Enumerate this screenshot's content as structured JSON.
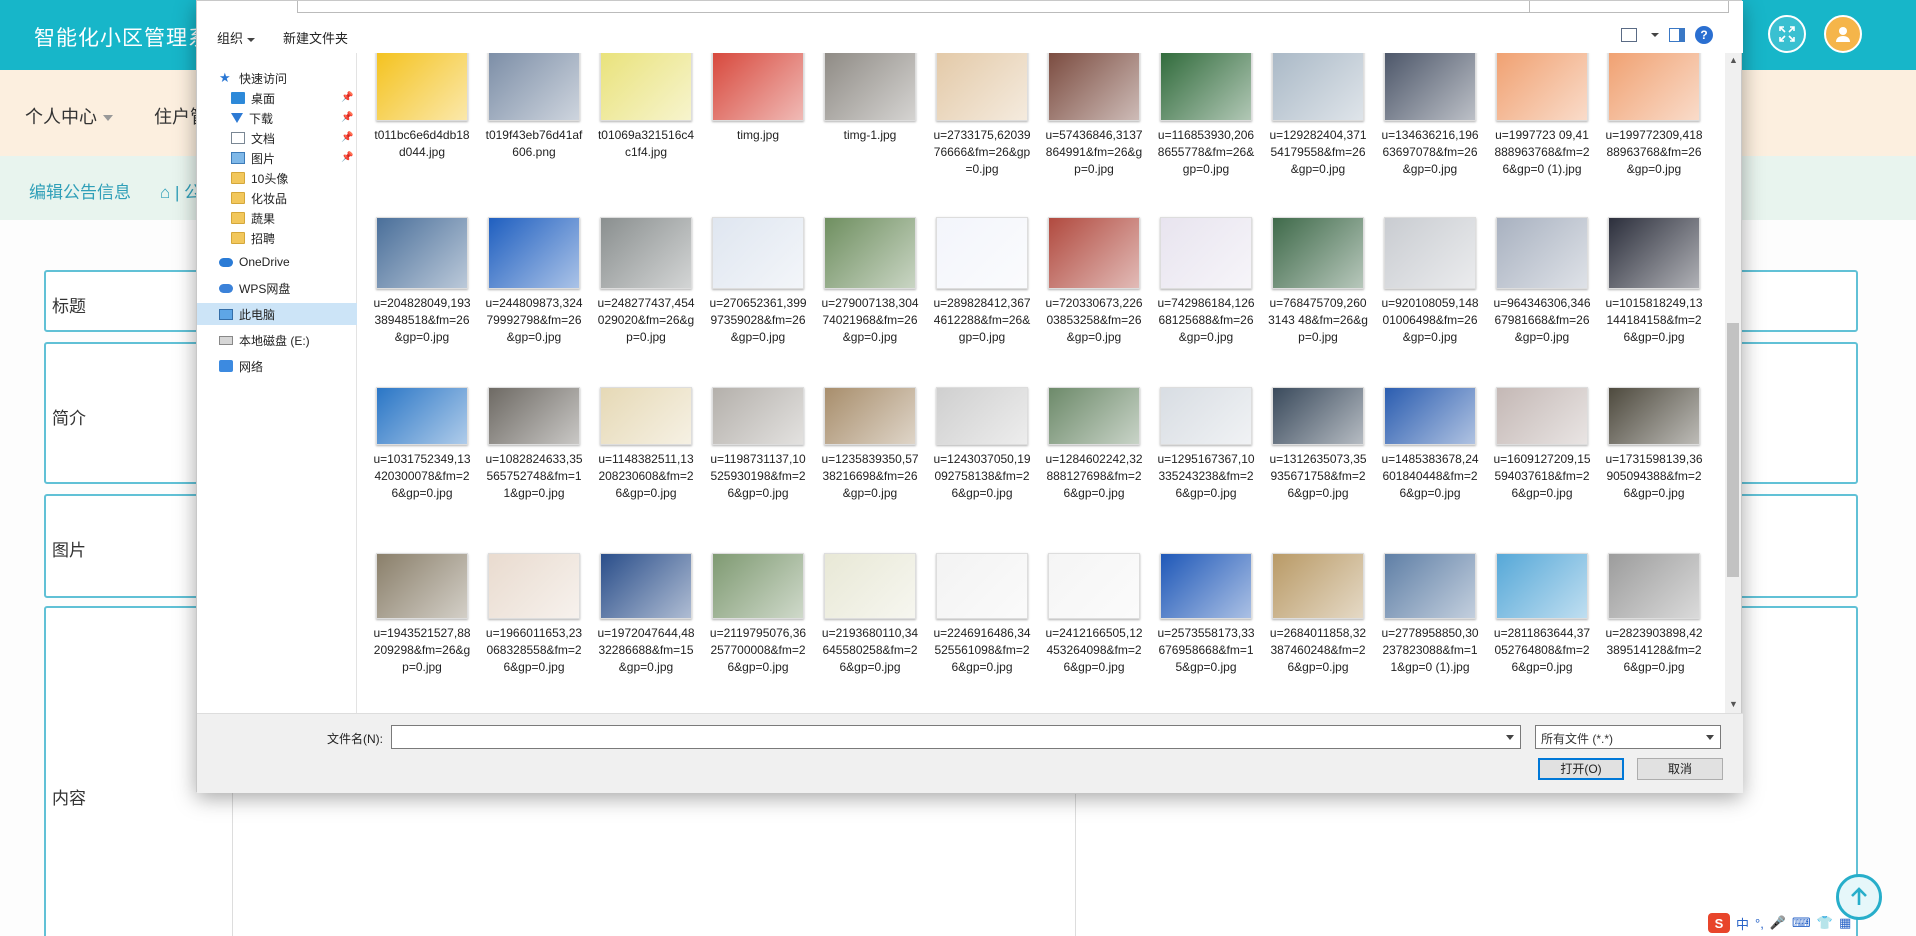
{
  "app": {
    "title": "智能化小区管理系统",
    "nav": [
      {
        "label": "个人中心",
        "has_caret": true
      },
      {
        "label": "住户管",
        "has_caret": false
      }
    ],
    "breadcrumb": {
      "current": "编辑公告信息",
      "home_sep": "⌂ | 公"
    },
    "form_labels": {
      "title": "标题",
      "summary": "简介",
      "image": "图片",
      "content": "内容"
    },
    "icons": {
      "fullscreen": "fullscreen-icon",
      "avatar": "user-avatar-icon",
      "back_to_top": "arrow-up-icon"
    }
  },
  "dialog": {
    "toolbar": {
      "organize": "组织",
      "new_folder": "新建文件夹"
    },
    "nav_pane": [
      {
        "label": "快速访问",
        "icon": "star",
        "pinned": false
      },
      {
        "label": "桌面",
        "icon": "desk",
        "pinned": true
      },
      {
        "label": "下载",
        "icon": "down",
        "pinned": true
      },
      {
        "label": "文档",
        "icon": "doc",
        "pinned": true
      },
      {
        "label": "图片",
        "icon": "pic",
        "pinned": true
      },
      {
        "label": "10头像",
        "icon": "folder",
        "pinned": false
      },
      {
        "label": "化妆品",
        "icon": "folder",
        "pinned": false
      },
      {
        "label": "蔬果",
        "icon": "folder",
        "pinned": false
      },
      {
        "label": "招聘",
        "icon": "folder",
        "pinned": false
      },
      {
        "label": "OneDrive",
        "icon": "cloud",
        "pinned": false
      },
      {
        "label": "WPS网盘",
        "icon": "wps",
        "pinned": false
      },
      {
        "label": "此电脑",
        "icon": "pc",
        "pinned": false,
        "selected": true
      },
      {
        "label": "本地磁盘 (E:)",
        "icon": "disk",
        "pinned": false
      },
      {
        "label": "网络",
        "icon": "net",
        "pinned": false
      }
    ],
    "files": [
      {
        "name": "t011bc6e6d4db18d044.jpg",
        "color": "#f4c21d"
      },
      {
        "name": "t019f43eb76d41af606.png",
        "color": "#7b8da6"
      },
      {
        "name": "t01069a321516c4c1f4.jpg",
        "color": "#e9e27a"
      },
      {
        "name": "timg.jpg",
        "color": "#d7473b"
      },
      {
        "name": "timg-1.jpg",
        "color": "#8e8a84"
      },
      {
        "name": "u=2733175,6203976666&fm=26&gp=0.jpg",
        "color": "#e3c9a7"
      },
      {
        "name": "u=57436846,3137864991&fm=26&gp=0.jpg",
        "color": "#7a4a3e"
      },
      {
        "name": "u=116853930,2068655778&fm=26&gp=0.jpg",
        "color": "#2f6a3a"
      },
      {
        "name": "u=129282404,37154179558&fm=26&gp=0.jpg",
        "color": "#a9b8c6"
      },
      {
        "name": "u=134636216,19663697078&fm=26&gp=0.jpg",
        "color": "#4b5568"
      },
      {
        "name": "u=1997723 09,41888963768&fm=26&gp=0 (1).jpg",
        "color": "#f0a070"
      },
      {
        "name": "u=199772309,41888963768&fm=26&gp=0.jpg",
        "color": "#f0a070"
      },
      {
        "name": "u=204828049,19338948518&fm=26&gp=0.jpg",
        "color": "#4a6f9a"
      },
      {
        "name": "u=244809873,32479992798&fm=26&gp=0.jpg",
        "color": "#1f5fc0"
      },
      {
        "name": "u=248277437,454029020&fm=26&gp=0.jpg",
        "color": "#8a8f8f"
      },
      {
        "name": "u=270652361,39997359028&fm=26&gp=0.jpg",
        "color": "#dfe6f0"
      },
      {
        "name": "u=279007138,30474021968&fm=26&gp=0.jpg",
        "color": "#6f8f60"
      },
      {
        "name": "u=289828412,3674612288&fm=26&gp=0.jpg",
        "color": "#f3f5fb"
      },
      {
        "name": "u=720330673,22603853258&fm=26&gp=0.jpg",
        "color": "#b14a3f"
      },
      {
        "name": "u=742986184,12668125688&fm=26&gp=0.jpg",
        "color": "#e8e4ef"
      },
      {
        "name": "u=768475709,2603143 48&fm=26&gp=0.jpg",
        "color": "#3f6a4a"
      },
      {
        "name": "u=920108059,14801006498&fm=26&gp=0.jpg",
        "color": "#c9ccd1"
      },
      {
        "name": "u=964346306,34667981668&fm=26&gp=0.jpg",
        "color": "#a8b1c0"
      },
      {
        "name": "u=1015818249,13144184158&fm=26&gp=0.jpg",
        "color": "#2c2f3c"
      },
      {
        "name": "u=1031752349,13420300078&fm=26&gp=0.jpg",
        "color": "#2a76c6"
      },
      {
        "name": "u=1082824633,35565752748&fm=11&gp=0.jpg",
        "color": "#6e6a64"
      },
      {
        "name": "u=1148382511,13208230608&fm=26&gp=0.jpg",
        "color": "#e6d9b6"
      },
      {
        "name": "u=1198731137,10525930198&fm=26&gp=0.jpg",
        "color": "#b4b0ab"
      },
      {
        "name": "u=1235839350,5738216698&fm=26&gp=0.jpg",
        "color": "#a88e6c"
      },
      {
        "name": "u=1243037050,19092758138&fm=26&gp=0.jpg",
        "color": "#cfcfcf"
      },
      {
        "name": "u=1284602242,32888127698&fm=26&gp=0.jpg",
        "color": "#6d8a6a"
      },
      {
        "name": "u=1295167367,10335243238&fm=26&gp=0.jpg",
        "color": "#d8dde3"
      },
      {
        "name": "u=1312635073,35935671758&fm=26&gp=0.jpg",
        "color": "#3a4a5c"
      },
      {
        "name": "u=1485383678,24601840448&fm=26&gp=0.jpg",
        "color": "#2b5db0"
      },
      {
        "name": "u=1609127209,15594037618&fm=26&gp=0.jpg",
        "color": "#c4b8b5"
      },
      {
        "name": "u=1731598139,36905094388&fm=26&gp=0.jpg",
        "color": "#4e4a3e"
      },
      {
        "name": "u=1943521527,88209298&fm=26&gp=0.jpg",
        "color": "#8a7f6a"
      },
      {
        "name": "u=1966011653,23068328558&fm=26&gp=0.jpg",
        "color": "#e9dbcf"
      },
      {
        "name": "u=1972047644,4832286688&fm=15&gp=0.jpg",
        "color": "#2a4e8a"
      },
      {
        "name": "u=2119795076,36257700008&fm=26&gp=0.jpg",
        "color": "#7f9a72"
      },
      {
        "name": "u=2193680110,34645580258&fm=26&gp=0.jpg",
        "color": "#e8e8d6"
      },
      {
        "name": "u=2246916486,34525561098&fm=26&gp=0.jpg",
        "color": "#f3f3f3"
      },
      {
        "name": "u=2412166505,12453264098&fm=26&gp=0.jpg",
        "color": "#f5f5f5"
      },
      {
        "name": "u=2573558173,33676958668&fm=15&gp=0.jpg",
        "color": "#1f58b8"
      },
      {
        "name": "u=2684011858,32387460248&fm=26&gp=0.jpg",
        "color": "#b99a66"
      },
      {
        "name": "u=2778958850,30237823088&fm=11&gp=0 (1).jpg",
        "color": "#5f7fa6"
      },
      {
        "name": "u=2811863644,37052764808&fm=26&gp=0.jpg",
        "color": "#56a8d8"
      },
      {
        "name": "u=2823903898,42389514128&fm=26&gp=0.jpg",
        "color": "#9c9c9c"
      }
    ],
    "filename_label": "文件名(N):",
    "filename_value": "",
    "filetype_value": "所有文件 (*.*)",
    "open_button": "打开(O)",
    "cancel_button": "取消"
  },
  "tray": {
    "ime": "中",
    "s_logo": "S"
  }
}
